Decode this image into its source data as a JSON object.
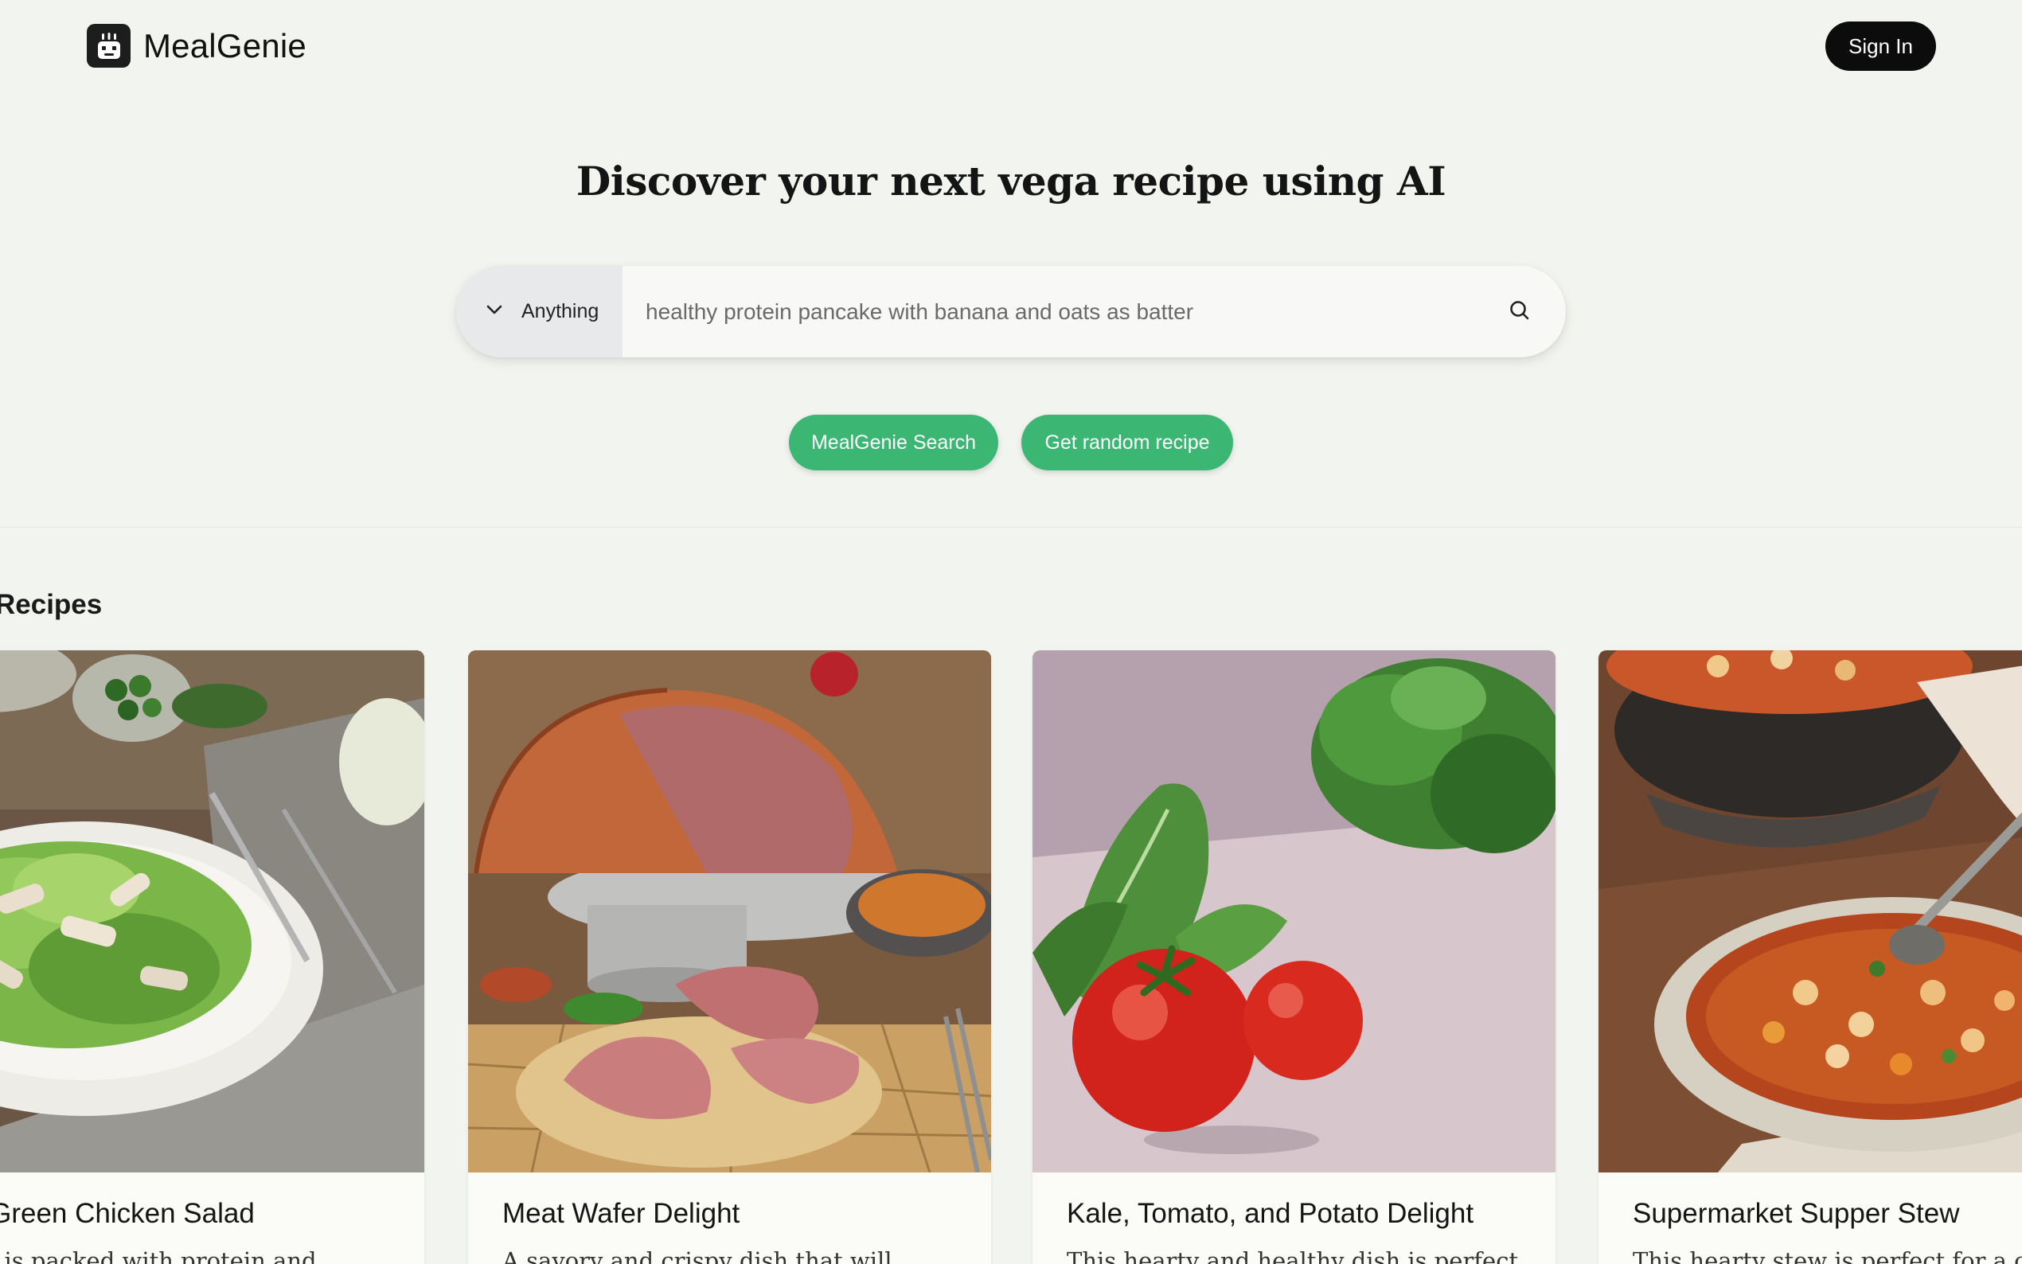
{
  "header": {
    "logo_text": "MealGenie",
    "signin_label": "Sign In"
  },
  "hero": {
    "title_before": "Discover your next ",
    "title_bold": "vega",
    "title_after": " recipe using AI"
  },
  "search": {
    "filter_label": "Anything",
    "placeholder": "healthy protein pancake with banana and oats as batter"
  },
  "actions": {
    "search_label": "MealGenie Search",
    "random_label": "Get random recipe"
  },
  "recipes": {
    "section_title": "Recipes",
    "cards": [
      {
        "title": "and Green Chicken Salad",
        "desc": "salad is packed with protein and"
      },
      {
        "title": "Meat Wafer Delight",
        "desc": "A savory and crispy dish that will"
      },
      {
        "title": "Kale, Tomato, and Potato Delight",
        "desc": "This hearty and healthy dish is perfect"
      },
      {
        "title": "Supermarket Supper Stew",
        "desc": "This hearty stew is perfect for a co"
      }
    ]
  },
  "colors": {
    "background": "#f2f4ef",
    "accent_green": "#3bb673",
    "dark": "#0c0c0c"
  },
  "icons": {
    "logo": "robot-chef-icon",
    "filter": "chevron-down-icon",
    "search": "search-icon"
  }
}
